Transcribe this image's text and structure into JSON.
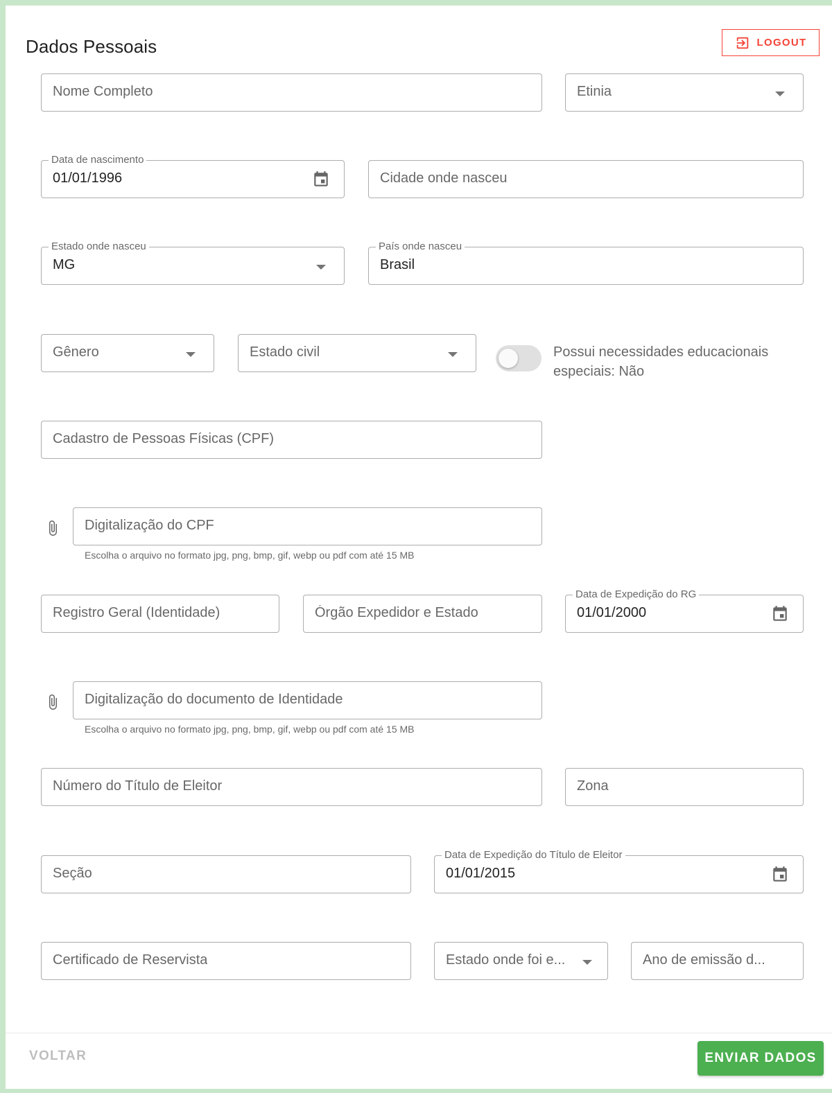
{
  "header": {
    "title": "Dados Pessoais",
    "logout_label": "LOGOUT"
  },
  "fields": {
    "nome_completo": {
      "placeholder": "Nome Completo"
    },
    "etnia": {
      "placeholder": "Etinia"
    },
    "data_nascimento": {
      "label": "Data de nascimento",
      "value": "01/01/1996"
    },
    "cidade_nascimento": {
      "placeholder": "Cidade onde nasceu"
    },
    "estado_nascimento": {
      "label": "Estado onde nasceu",
      "value": "MG"
    },
    "pais_nascimento": {
      "label": "País onde nasceu",
      "value": "Brasil"
    },
    "genero": {
      "placeholder": "Gênero"
    },
    "estado_civil": {
      "placeholder": "Estado civil"
    },
    "cpf": {
      "placeholder": "Cadastro de Pessoas Físicas (CPF)"
    },
    "cpf_scan": {
      "placeholder": "Digitalização do CPF",
      "hint": "Escolha o arquivo no formato jpg, png, bmp, gif, webp ou pdf com até 15 MB"
    },
    "rg": {
      "placeholder": "Registro Geral (Identidade)"
    },
    "orgao_expedidor": {
      "placeholder": "Órgão Expedidor e Estado"
    },
    "data_expedicao_rg": {
      "label": "Data de Expedição do RG",
      "value": "01/01/2000"
    },
    "rg_scan": {
      "placeholder": "Digitalização do documento de Identidade",
      "hint": "Escolha o arquivo no formato jpg, png, bmp, gif, webp ou pdf com até 15 MB"
    },
    "titulo_eleitor": {
      "placeholder": "Número do Título de Eleitor"
    },
    "zona": {
      "placeholder": "Zona"
    },
    "secao": {
      "placeholder": "Seção"
    },
    "data_expedicao_titulo": {
      "label": "Data de Expedição do Título de Eleitor",
      "value": "01/01/2015"
    },
    "reservista": {
      "placeholder": "Certificado de Reservista"
    },
    "estado_emissao": {
      "placeholder": "Estado onde foi e..."
    },
    "ano_emissao": {
      "placeholder": "Ano de emissão d..."
    }
  },
  "toggle": {
    "label": "Possui necessidades educacionais especiais: Não",
    "checked": false
  },
  "footer": {
    "back_label": "VOLTAR",
    "submit_label": "ENVIAR DADOS"
  },
  "colors": {
    "primary_green": "#4caf50",
    "logout_red": "#f44336",
    "frame_green": "#c8e6c9"
  }
}
